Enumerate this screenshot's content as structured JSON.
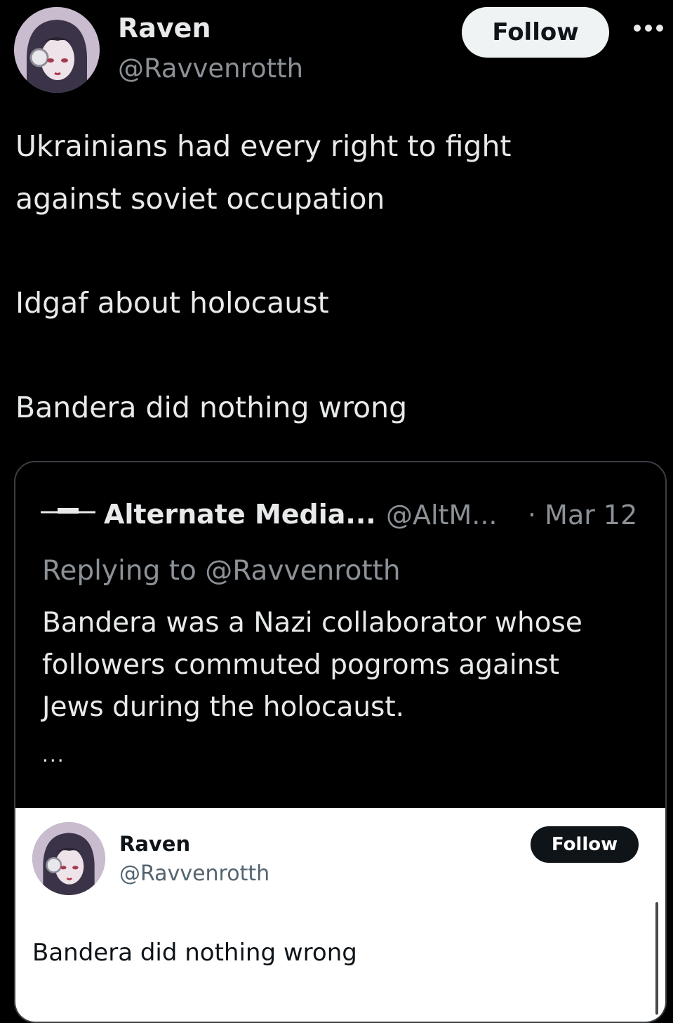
{
  "tweet": {
    "author_name": "Raven",
    "author_handle": "@Ravvenrotth",
    "follow_label": "Follow",
    "more_icon": "more-horizontal-icon",
    "text_lines": [
      "Ukrainians had every right to fight",
      "against soviet occupation",
      "Idgaf about holocaust",
      "Bandera did nothing wrong"
    ]
  },
  "quote": {
    "author_name": "Alternate Media...",
    "author_handle": "@AltM...",
    "date": "· Mar 12",
    "replying_to": "Replying to @Ravvenrotth",
    "text_lines": [
      "Bandera was a Nazi collaborator whose",
      "followers commuted pogroms against",
      "Jews during the holocaust."
    ],
    "ellipsis": "..."
  },
  "embedded": {
    "author_name": "Raven",
    "author_handle": "@Ravvenrotth",
    "follow_label": "Follow",
    "text": "Bandera did nothing wrong"
  },
  "colors": {
    "background": "#000000",
    "text": "#e7e9ea",
    "muted": "#8b9196",
    "follow_bg": "#eff3f4",
    "embedded_bg": "#ffffff",
    "embedded_follow_bg": "#0f1419"
  }
}
